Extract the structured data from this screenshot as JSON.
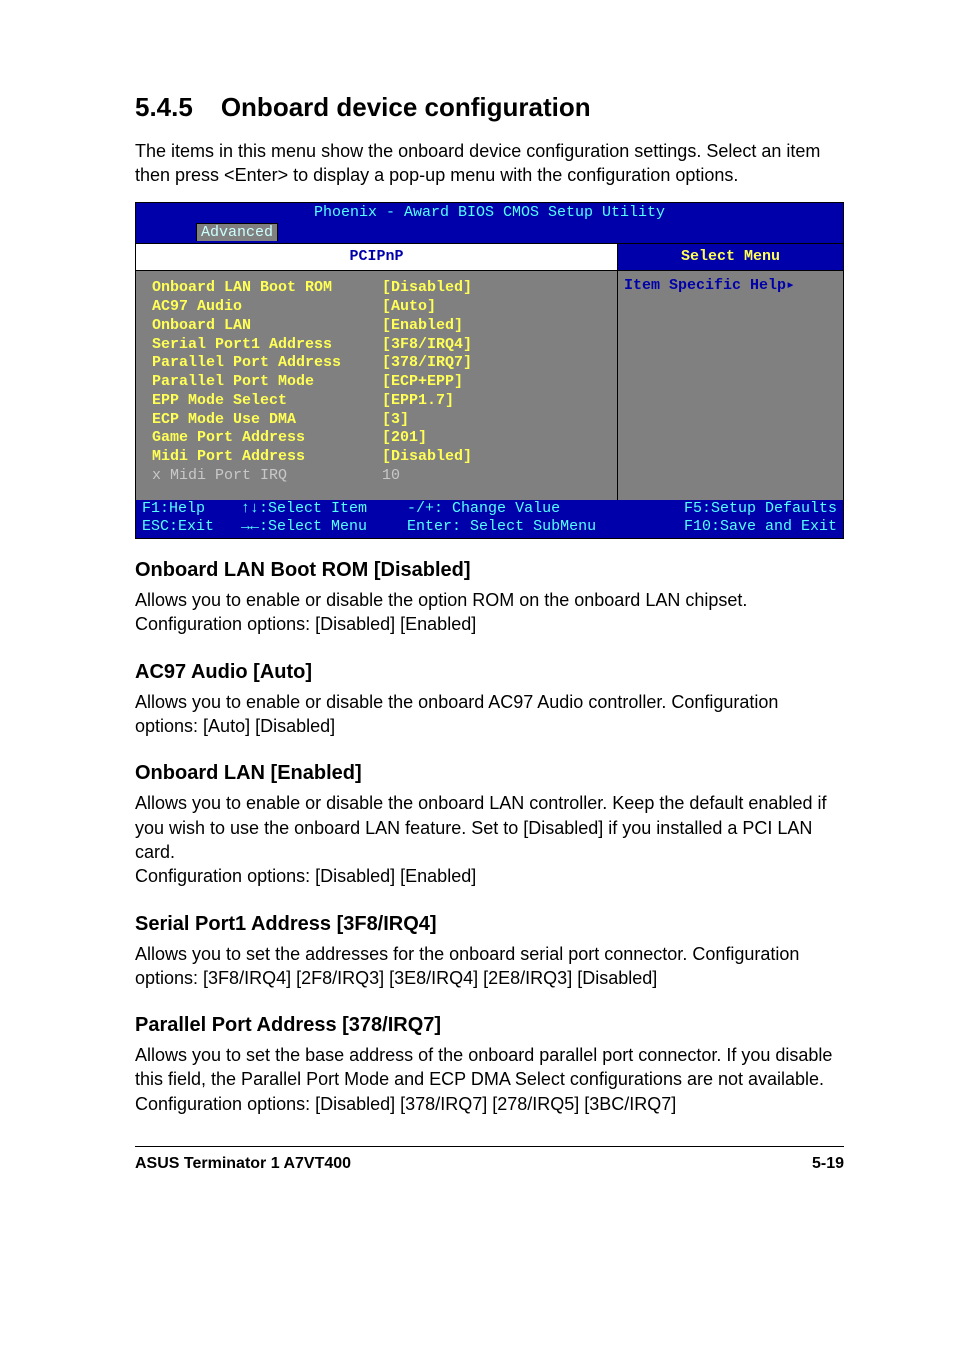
{
  "heading": {
    "number": "5.4.5",
    "title": "Onboard device configuration"
  },
  "intro": "The items in this menu show the onboard device configuration settings. Select an item then press <Enter> to display a pop-up menu with the configuration options.",
  "bios": {
    "title": "Phoenix - Award BIOS CMOS Setup Utility",
    "tab": "Advanced",
    "leftHeader": "PCIPnP",
    "rightHeader": "Select Menu",
    "help": "Item Specific Help",
    "items": [
      {
        "label": "Onboard LAN Boot ROM",
        "value": "[Disabled]",
        "disabled": false
      },
      {
        "label": "AC97 Audio",
        "value": "[Auto]",
        "disabled": false
      },
      {
        "label": "Onboard LAN",
        "value": "[Enabled]",
        "disabled": false
      },
      {
        "label": "Serial Port1 Address",
        "value": "[3F8/IRQ4]",
        "disabled": false
      },
      {
        "label": "Parallel Port Address",
        "value": "[378/IRQ7]",
        "disabled": false
      },
      {
        "label": "Parallel Port Mode",
        "value": "[ECP+EPP]",
        "disabled": false
      },
      {
        "label": "EPP Mode Select",
        "value": "[EPP1.7]",
        "disabled": false
      },
      {
        "label": "ECP Mode Use DMA",
        "value": "[3]",
        "disabled": false
      },
      {
        "label": "Game Port Address",
        "value": "[201]",
        "disabled": false
      },
      {
        "label": "Midi Port Address",
        "value": "[Disabled]",
        "disabled": false
      },
      {
        "label": "x Midi Port IRQ",
        "value": "10",
        "disabled": true
      }
    ],
    "footer": {
      "col1": "F1:Help    ↑↓:Select Item\nESC:Exit   →←:Select Menu",
      "col2": "-/+: Change Value\nEnter: Select SubMenu",
      "col3": "F5:Setup Defaults\nF10:Save and Exit"
    }
  },
  "sections": [
    {
      "title": "Onboard LAN Boot ROM [Disabled]",
      "body": "Allows you to enable or disable the option ROM on the onboard LAN chipset. Configuration options: [Disabled] [Enabled]"
    },
    {
      "title": "AC97 Audio [Auto]",
      "body": "Allows you to enable or disable the onboard AC97 Audio controller. Configuration options: [Auto] [Disabled]"
    },
    {
      "title": "Onboard LAN [Enabled]",
      "body": "Allows you to enable or disable the onboard LAN controller. Keep the default enabled if you wish to use the onboard LAN feature. Set to [Disabled] if you installed a PCI LAN card.\nConfiguration options: [Disabled] [Enabled]"
    },
    {
      "title": "Serial Port1 Address [3F8/IRQ4]",
      "body": "Allows you to set the addresses for the onboard serial port connector. Configuration options: [3F8/IRQ4] [2F8/IRQ3] [3E8/IRQ4] [2E8/IRQ3] [Disabled]"
    },
    {
      "title": "Parallel Port Address [378/IRQ7]",
      "body": "Allows you to set the base address of the onboard parallel port connector. If you disable this field, the Parallel Port Mode and ECP DMA Select configurations are not available. Configuration options: [Disabled] [378/IRQ7] [278/IRQ5] [3BC/IRQ7]"
    }
  ],
  "footer": {
    "left": "ASUS Terminator 1 A7VT400",
    "right": "5-19"
  }
}
